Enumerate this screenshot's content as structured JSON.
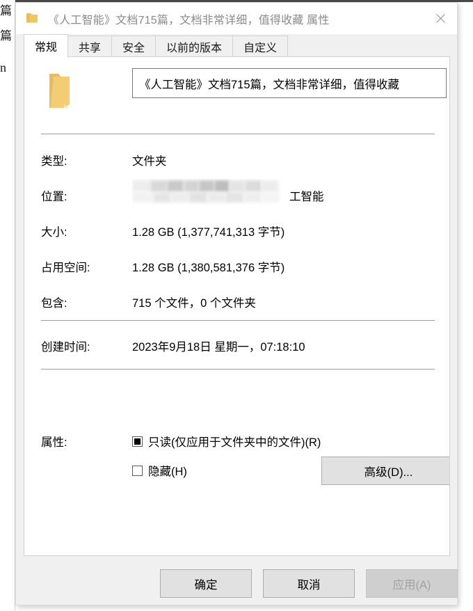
{
  "background": {
    "fragments": [
      "篇",
      "篇",
      "n"
    ]
  },
  "dialog": {
    "title": "《人工智能》文档715篇，文档非常详细，值得收藏 属性",
    "title_icon": "folder-icon",
    "close_icon": "close-icon"
  },
  "tabs": [
    {
      "label": "常规",
      "active": true
    },
    {
      "label": "共享",
      "active": false
    },
    {
      "label": "安全",
      "active": false
    },
    {
      "label": "以前的版本",
      "active": false
    },
    {
      "label": "自定义",
      "active": false
    }
  ],
  "general": {
    "folder_icon": "folder-icon",
    "name_value": "《人工智能》文档715篇，文档非常详细，值得收藏",
    "name_placeholder": "",
    "rows": [
      {
        "label": "类型:",
        "value": "文件夹"
      },
      {
        "label": "位置:",
        "value": "",
        "redacted": true,
        "value_tail": "工智能"
      },
      {
        "label": "大小:",
        "value": "1.28 GB (1,377,741,313 字节)"
      },
      {
        "label": "占用空间:",
        "value": "1.28 GB (1,380,581,376 字节)"
      },
      {
        "label": "包含:",
        "value": "715 个文件，0 个文件夹"
      },
      {
        "label": "创建时间:",
        "value": "2023年9月18日 星期一，07:18:10"
      }
    ],
    "attributes": {
      "label": "属性:",
      "readonly_label": "只读(仅应用于文件夹中的文件)(R)",
      "readonly_state": "indeterminate",
      "hidden_label": "隐藏(H)",
      "hidden_state": "unchecked",
      "advanced_button": "高级(D)..."
    }
  },
  "footer": {
    "ok": "确定",
    "cancel": "取消",
    "apply": "应用(A)",
    "apply_disabled": true
  },
  "colors": {
    "folder": "#f5cd79",
    "folder_dark": "#e8bd62",
    "accent": "#0078d7",
    "dialog_bg": "#f0f0f0",
    "page_bg": "#ffffff",
    "button_bg": "#e1e1e1",
    "disabled_text": "#a2a2a2",
    "title_text": "#8a8a8a"
  }
}
